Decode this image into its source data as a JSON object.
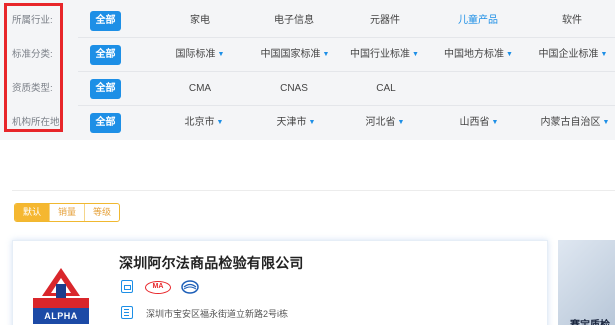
{
  "filters": [
    {
      "label": "所属行业:",
      "all_label": "全部",
      "options": [
        {
          "text": "家电",
          "dropdown": false,
          "active": false
        },
        {
          "text": "电子信息",
          "dropdown": false,
          "active": false
        },
        {
          "text": "元器件",
          "dropdown": false,
          "active": false
        },
        {
          "text": "儿童产品",
          "dropdown": false,
          "active": true
        },
        {
          "text": "软件",
          "dropdown": false,
          "active": false
        }
      ]
    },
    {
      "label": "标准分类:",
      "all_label": "全部",
      "options": [
        {
          "text": "国际标准",
          "dropdown": true,
          "active": false
        },
        {
          "text": "中国国家标准",
          "dropdown": true,
          "active": false
        },
        {
          "text": "中国行业标准",
          "dropdown": true,
          "active": false
        },
        {
          "text": "中国地方标准",
          "dropdown": true,
          "active": false
        },
        {
          "text": "中国企业标准",
          "dropdown": true,
          "active": false
        }
      ]
    },
    {
      "label": "资质类型:",
      "all_label": "全部",
      "options": [
        {
          "text": "CMA",
          "dropdown": false,
          "active": false
        },
        {
          "text": "CNAS",
          "dropdown": false,
          "active": false
        },
        {
          "text": "CAL",
          "dropdown": false,
          "active": false
        }
      ]
    },
    {
      "label": "机构所在地:",
      "all_label": "全部",
      "options": [
        {
          "text": "北京市",
          "dropdown": true,
          "active": false
        },
        {
          "text": "天津市",
          "dropdown": true,
          "active": false
        },
        {
          "text": "河北省",
          "dropdown": true,
          "active": false
        },
        {
          "text": "山西省",
          "dropdown": true,
          "active": false
        },
        {
          "text": "内蒙古自治区",
          "dropdown": true,
          "active": false
        }
      ]
    }
  ],
  "sort": {
    "items": [
      "默认",
      "销量",
      "等级"
    ],
    "active_index": 0
  },
  "listing": {
    "company_name": "深圳阿尔法商品检验有限公司",
    "logo_text": "ALPHA",
    "cert_ma_text": "MA",
    "address": "深圳市宝安区福永街道立新路2号i栋",
    "side_card_text": "赛宝质检"
  },
  "colors": {
    "accent_blue": "#1d8fe6",
    "highlight_red": "#e8262a",
    "sort_orange": "#f5b730",
    "panel_bg": "#f4f5f7"
  },
  "icons": [
    "doc-icon",
    "ma-cert-icon",
    "cnas-cert-icon",
    "address-icon",
    "caret-down-icon"
  ]
}
